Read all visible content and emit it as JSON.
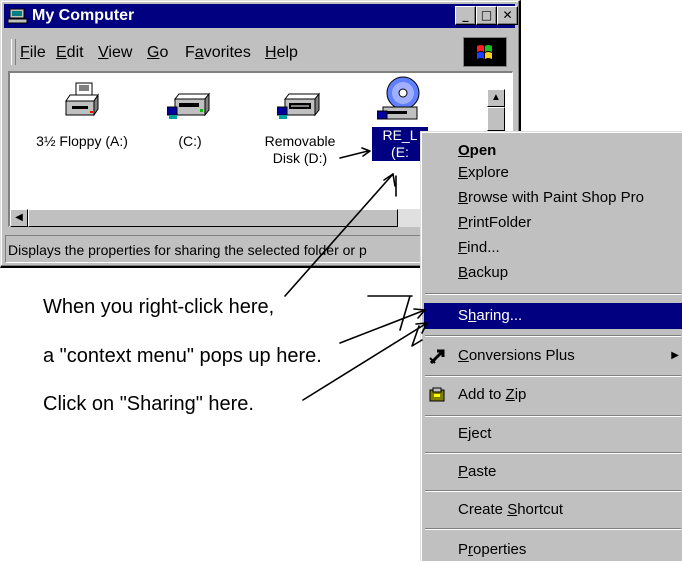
{
  "window": {
    "title": "My Computer",
    "controls": [
      "minimize-button",
      "maximize-button",
      "close-button"
    ]
  },
  "menubar": {
    "items": [
      {
        "pre": "",
        "u": "F",
        "post": "ile"
      },
      {
        "pre": "",
        "u": "E",
        "post": "dit"
      },
      {
        "pre": "",
        "u": "V",
        "post": "iew"
      },
      {
        "pre": "",
        "u": "G",
        "post": "o"
      },
      {
        "pre": "F",
        "u": "a",
        "post": "vorites"
      },
      {
        "pre": "",
        "u": "H",
        "post": "elp"
      }
    ]
  },
  "drives": [
    {
      "label": "3½ Floppy (A:)",
      "icon": "floppy-drive-icon"
    },
    {
      "label": "(C:)",
      "icon": "hard-drive-icon"
    },
    {
      "label_line1": "Removable",
      "label_line2": "Disk (D:)",
      "icon": "removable-disk-icon"
    },
    {
      "label_line1": "RE_L",
      "label_line2": "(E:",
      "icon": "cd-drive-icon",
      "selected": true
    }
  ],
  "status_text": "Displays the properties for sharing the selected folder or p",
  "context_menu": {
    "open": {
      "u": "O",
      "post": "pen"
    },
    "explore": {
      "u": "E",
      "post": "xplore"
    },
    "browse": {
      "u": "B",
      "post": "rowse with Paint Shop Pro"
    },
    "printfolder": {
      "u": "P",
      "post": "rintFolder"
    },
    "find": {
      "u": "F",
      "post": "ind..."
    },
    "backup": {
      "u": "B",
      "post": "ackup"
    },
    "sharing": {
      "pre": "S",
      "u": "h",
      "post": "aring..."
    },
    "conversions": {
      "u": "C",
      "post": "onversions Plus"
    },
    "addzip": {
      "pre": "Add to ",
      "u": "Z",
      "post": "ip"
    },
    "eject": {
      "pre": "E",
      "u": "j",
      "post": "ect"
    },
    "paste": {
      "u": "P",
      "post": "aste"
    },
    "shortcut": {
      "pre": "Create ",
      "u": "S",
      "post": "hortcut"
    },
    "properties": {
      "pre": "P",
      "u": "r",
      "post": "operties"
    }
  },
  "annotations": {
    "line1": "When you right-click here,",
    "line2": "a \"context menu\" pops up here.",
    "line3": "Click on \"Sharing\" here."
  },
  "colors": {
    "selection": "#000080",
    "face": "#c0c0c0"
  }
}
